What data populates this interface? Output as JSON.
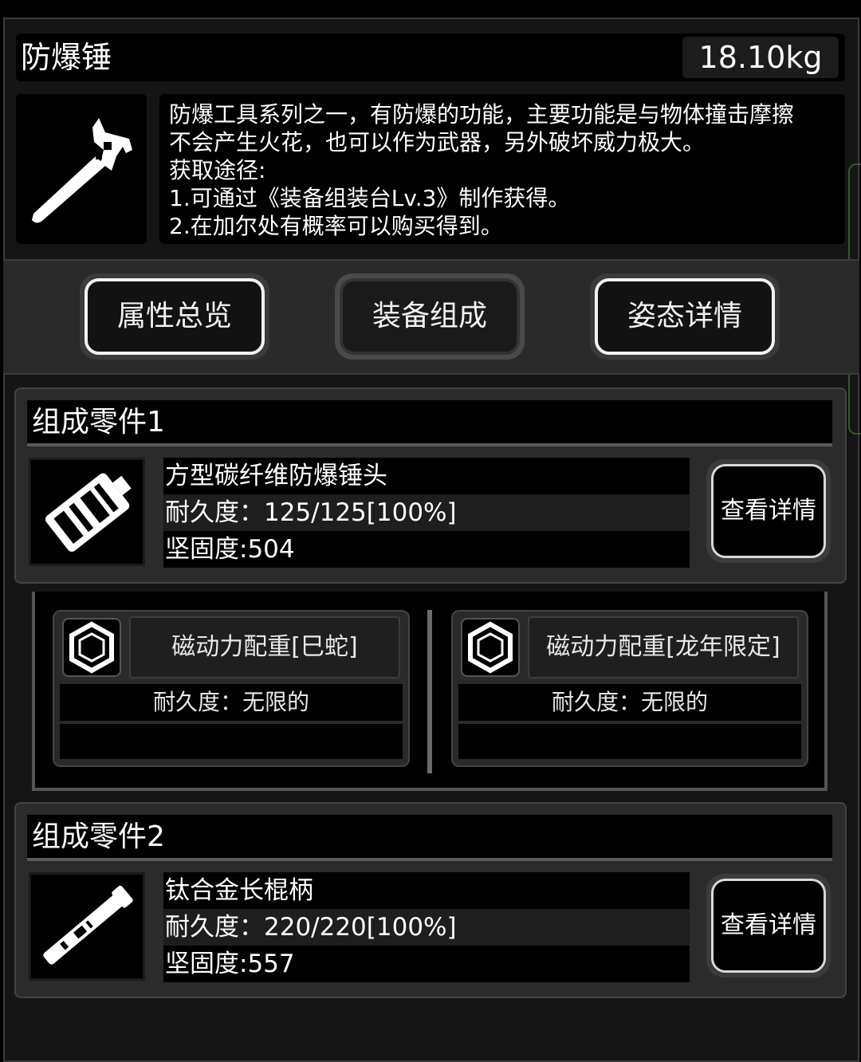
{
  "item": {
    "name": "防爆锤",
    "weight": "18.10kg",
    "icon": "hammer-icon",
    "description_lines": [
      "防爆工具系列之一，有防爆的功能，主要功能是与物体撞击摩擦",
      "不会产生火花，也可以作为武器，另外破坏威力极大。",
      "获取途径:",
      "1.可通过《装备组装台Lv.3》制作获得。",
      "2.在加尔处有概率可以购买得到。"
    ]
  },
  "tabs": [
    {
      "label": "属性总览"
    },
    {
      "label": "装备组成"
    },
    {
      "label": "姿态详情"
    }
  ],
  "parts": [
    {
      "header": "组成零件1",
      "icon": "hammer-head-icon",
      "name": "方型碳纤维防爆锤头",
      "durability": "耐久度：125/125[100%]",
      "hardness": "坚固度:504",
      "detail_label": "查看详情"
    },
    {
      "header": "组成零件2",
      "icon": "handle-icon",
      "name": "钛合金长棍柄",
      "durability": "耐久度：220/220[100%]",
      "hardness": "坚固度:557",
      "detail_label": "查看详情"
    }
  ],
  "accessories": [
    {
      "name": "磁动力配重[巳蛇]",
      "durability": "耐久度：无限的",
      "icon": "weight-icon"
    },
    {
      "name": "磁动力配重[龙年限定]",
      "durability": "耐久度：无限的",
      "icon": "weight-icon"
    }
  ],
  "colors": {
    "background": "#000000",
    "panel": "#2b2b2b",
    "text": "#ffffff"
  }
}
